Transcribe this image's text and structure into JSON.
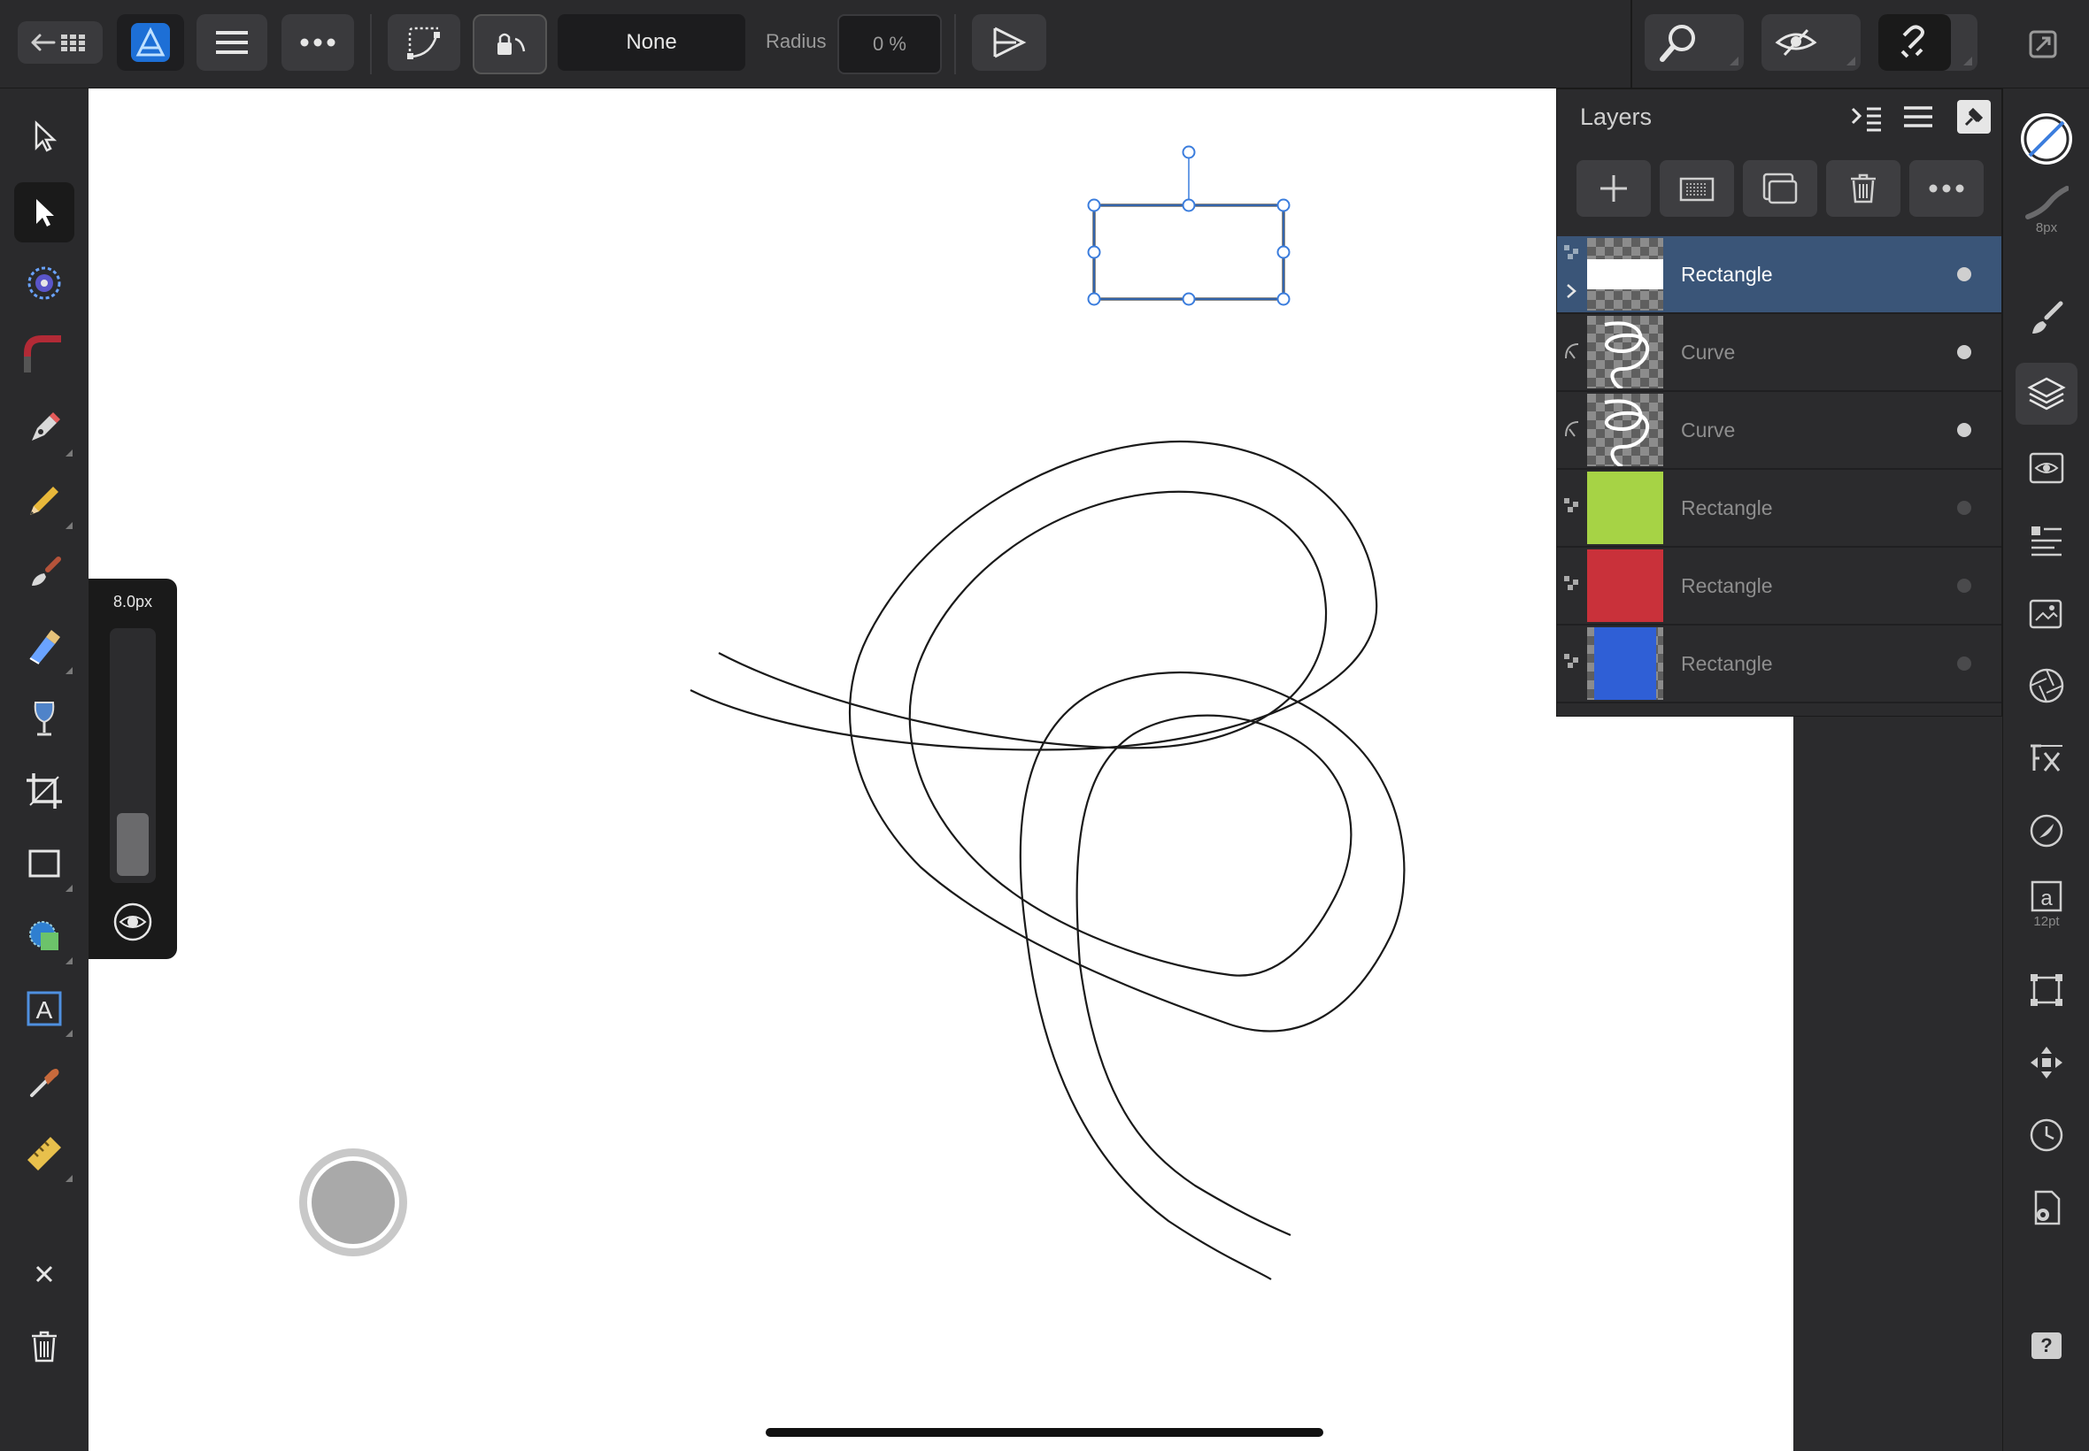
{
  "toolbar": {
    "corner_option": "None",
    "radius_label": "Radius",
    "radius_value": "0 %"
  },
  "brush_width": {
    "value": "8.0px",
    "level_fraction": 0.26
  },
  "layers_panel": {
    "title": "Layers",
    "items": [
      {
        "name": "Rectangle",
        "selected": true,
        "thumb": "white-rect",
        "color": "#ffffff"
      },
      {
        "name": "Curve",
        "selected": false,
        "thumb": "curve"
      },
      {
        "name": "Curve",
        "selected": false,
        "thumb": "curve"
      },
      {
        "name": "Rectangle",
        "selected": false,
        "thumb": "color",
        "color": "#a6d345"
      },
      {
        "name": "Rectangle",
        "selected": false,
        "thumb": "color",
        "color": "#c9313a"
      },
      {
        "name": "Rectangle",
        "selected": false,
        "thumb": "color",
        "color": "#2f5fd6"
      }
    ]
  },
  "right_studio": {
    "stroke_width_label": "8px",
    "text_size_label": "12pt",
    "help_label": "?"
  },
  "colors": {
    "accent": "#4a90e2",
    "selected_row": "#3a5578",
    "selection_handle": "#3b7ddd"
  }
}
